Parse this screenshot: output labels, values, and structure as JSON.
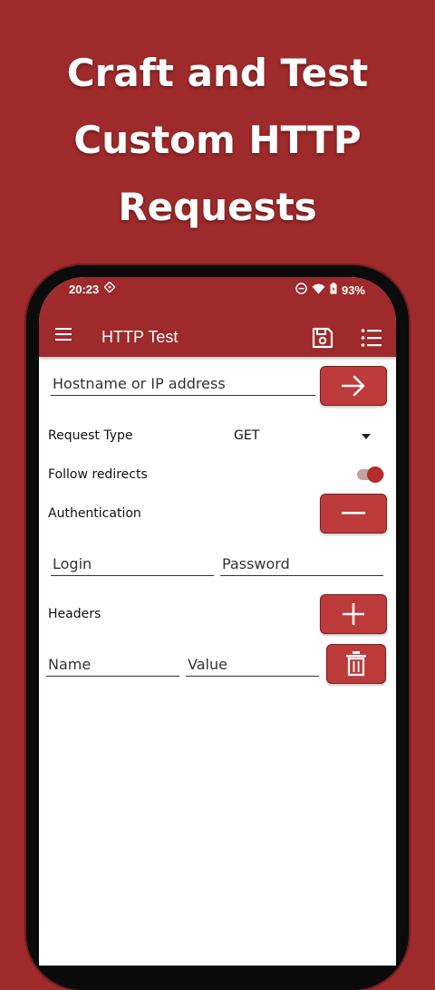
{
  "promo": {
    "line1": "Craft and Test",
    "line2": "Custom HTTP",
    "line3": "Requests"
  },
  "status_bar": {
    "time": "20:23",
    "battery": "93%"
  },
  "app_bar": {
    "title": "HTTP Test"
  },
  "form": {
    "host_placeholder": "Hostname or IP address",
    "request_type_label": "Request Type",
    "request_type_value": "GET",
    "follow_redirects_label": "Follow redirects",
    "follow_redirects_on": true,
    "authentication_label": "Authentication",
    "login_placeholder": "Login",
    "password_placeholder": "Password",
    "headers_label": "Headers",
    "header_name_placeholder": "Name",
    "header_value_placeholder": "Value"
  },
  "icons": {
    "menu": "menu-icon",
    "save": "save-icon",
    "list": "list-icon",
    "send": "arrow-right-icon",
    "remove_auth": "minus-icon",
    "add_header": "plus-icon",
    "delete_header": "trash-icon"
  },
  "colors": {
    "brand": "#9e2a2b",
    "button": "#bd3b3b",
    "switch_thumb": "#b32d2e"
  }
}
